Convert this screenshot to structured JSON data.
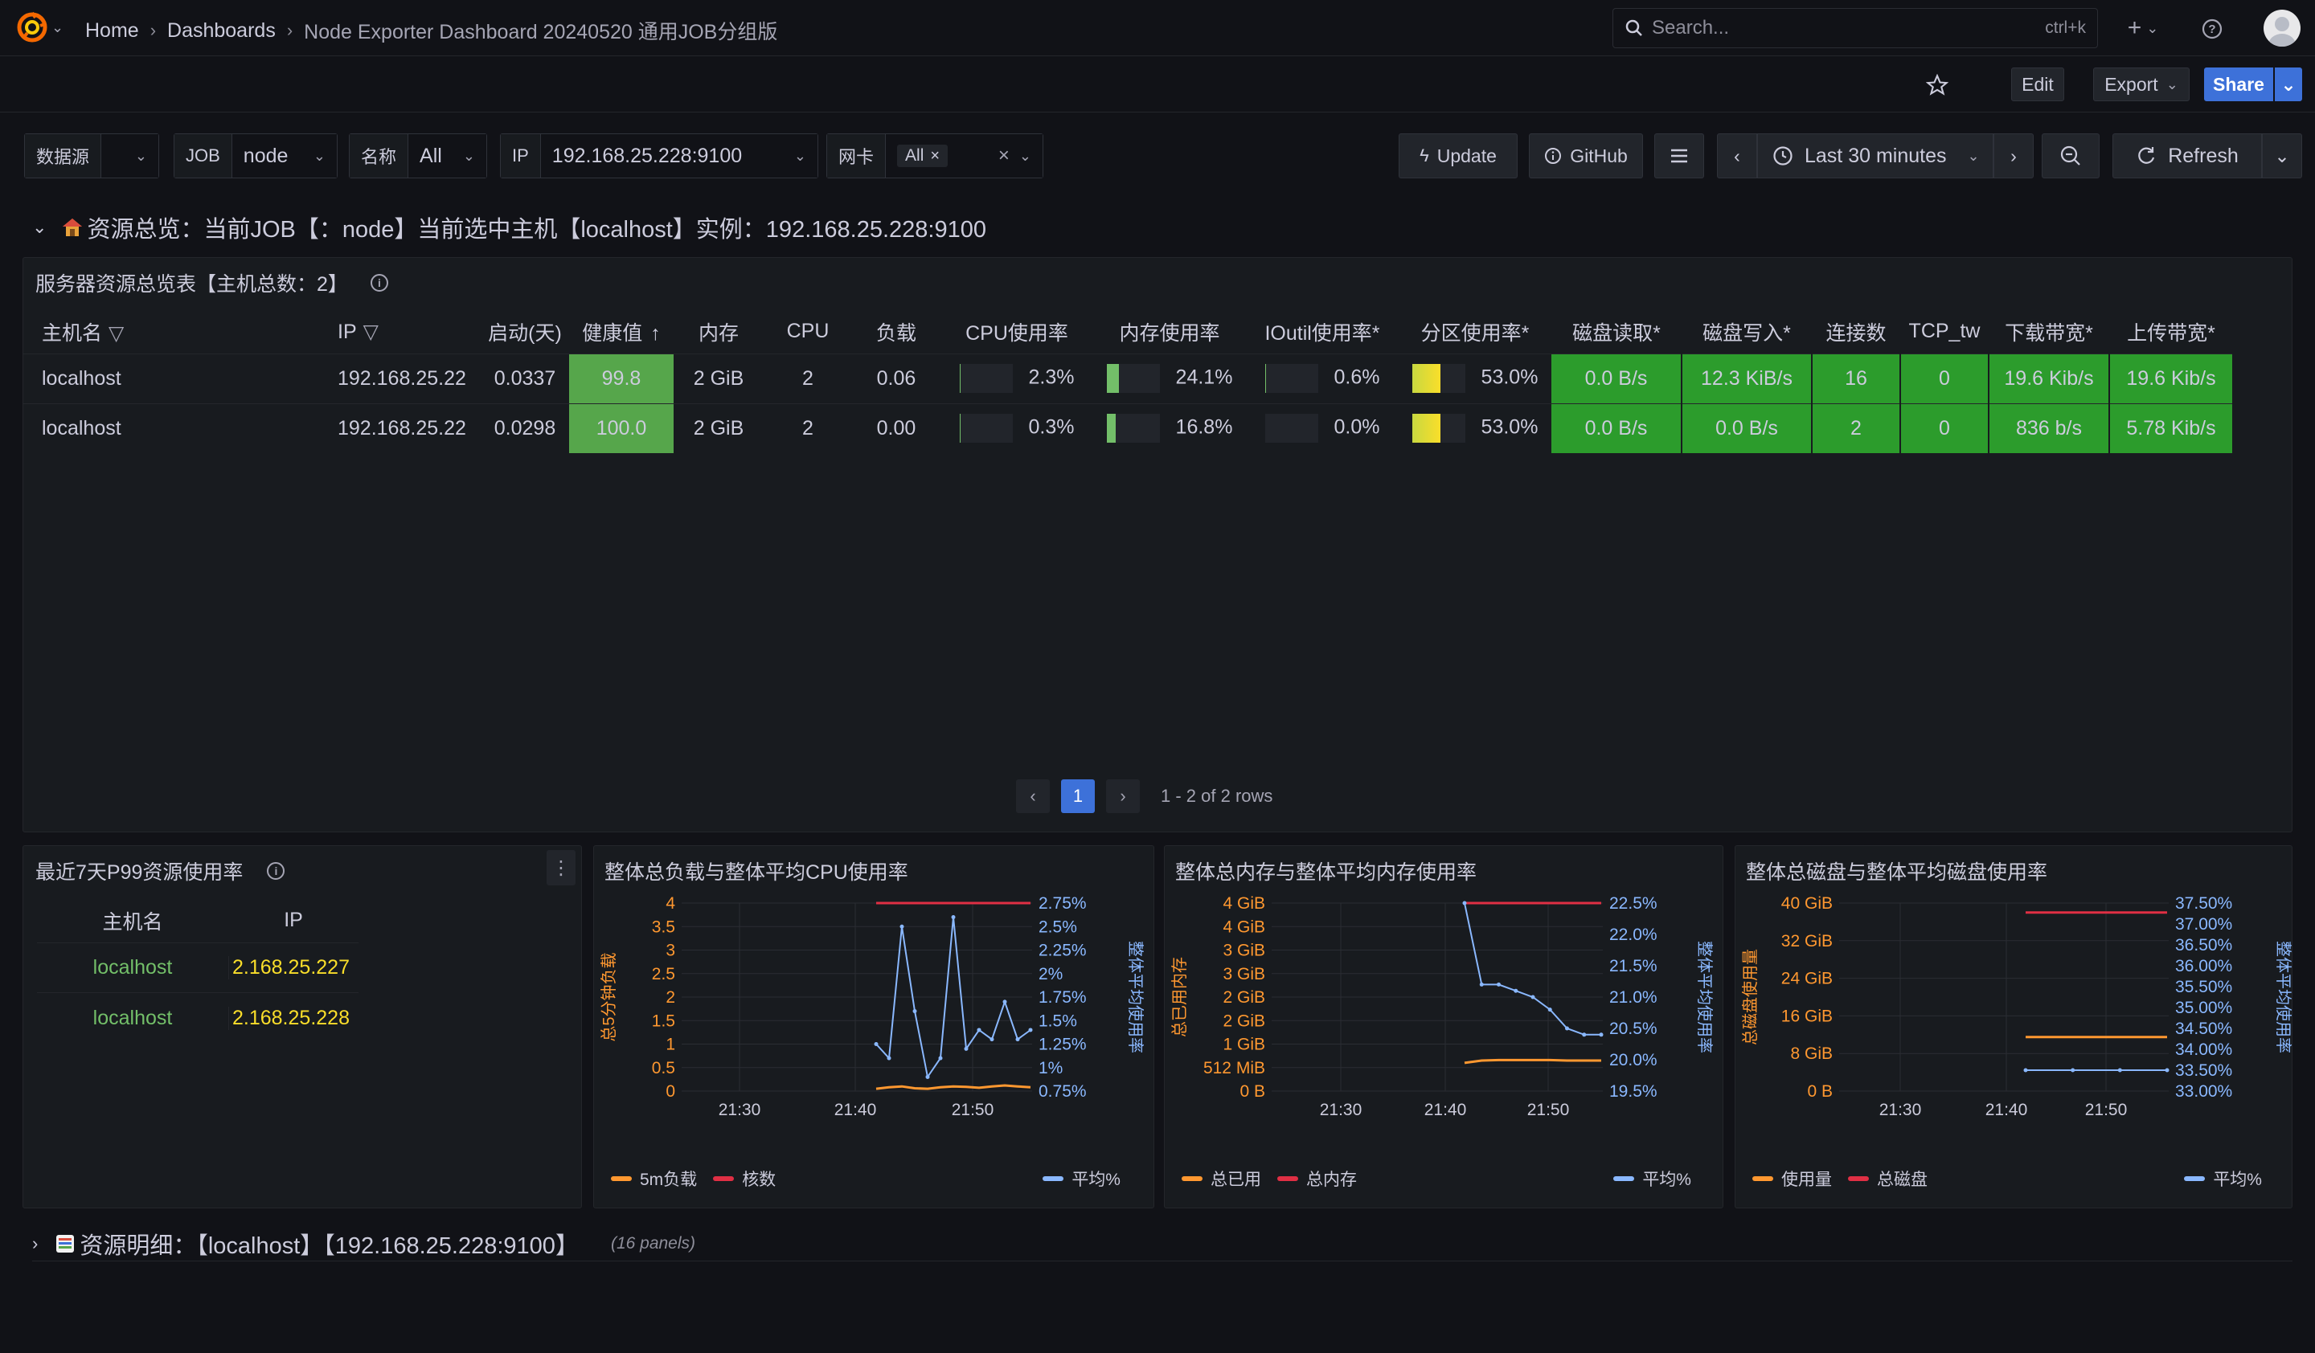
{
  "nav": {
    "breadcrumbs": [
      "Home",
      "Dashboards"
    ],
    "current": "Node Exporter Dashboard 20240520 通用JOB分组版",
    "search_placeholder": "Search...",
    "search_shortcut": "ctrl+k"
  },
  "actions": {
    "edit": "Edit",
    "export": "Export",
    "share": "Share"
  },
  "variables": {
    "datasource_label": "数据源",
    "job_label": "JOB",
    "job_value": "node",
    "name_label": "名称",
    "name_value": "All",
    "ip_label": "IP",
    "ip_value": "192.168.25.228:9100",
    "nic_label": "网卡",
    "nic_value": "All"
  },
  "toolbar": {
    "update": "Update",
    "github": "GitHub",
    "time_range": "Last 30 minutes",
    "refresh": "Refresh"
  },
  "row1": {
    "title": "资源总览：当前JOB【：node】当前选中主机【localhost】实例：192.168.25.228:9100"
  },
  "summary_panel": {
    "title": "服务器资源总览表【主机总数：2】",
    "columns": [
      "主机名",
      "IP",
      "启动(天)",
      "健康值",
      "内存",
      "CPU",
      "负载",
      "CPU使用率",
      "内存使用率",
      "IOutil使用率*",
      "分区使用率*",
      "磁盘读取*",
      "磁盘写入*",
      "连接数",
      "TCP_tw",
      "下载带宽*",
      "上传带宽*"
    ],
    "rows": [
      {
        "host": "localhost",
        "ip": "192.168.25.22",
        "uptime": "0.0337",
        "health": "99.8",
        "mem": "2 GiB",
        "cpu": "2",
        "load": "0.06",
        "cpu_pct": "2.3%",
        "cpu_frac": 0.023,
        "mem_pct": "24.1%",
        "mem_frac": 0.241,
        "io_pct": "0.6%",
        "io_frac": 0.006,
        "part_pct": "53.0%",
        "part_frac": 0.53,
        "disk_read": "0.0 B/s",
        "disk_write": "12.3 KiB/s",
        "conn": "16",
        "tcp_tw": "0",
        "down": "19.6 Kib/s",
        "up": "19.6 Kib/s"
      },
      {
        "host": "localhost",
        "ip": "192.168.25.22",
        "uptime": "0.0298",
        "health": "100.0",
        "mem": "2 GiB",
        "cpu": "2",
        "load": "0.00",
        "cpu_pct": "0.3%",
        "cpu_frac": 0.003,
        "mem_pct": "16.8%",
        "mem_frac": 0.168,
        "io_pct": "0.0%",
        "io_frac": 0.0,
        "part_pct": "53.0%",
        "part_frac": 0.53,
        "disk_read": "0.0 B/s",
        "disk_write": "0.0 B/s",
        "conn": "2",
        "tcp_tw": "0",
        "down": "836 b/s",
        "up": "5.78 Kib/s"
      }
    ],
    "pagination": {
      "page": "1",
      "summary": "1 - 2 of 2 rows"
    }
  },
  "p99_panel": {
    "title": "最近7天P99资源使用率",
    "columns": [
      "主机名",
      "IP"
    ],
    "rows": [
      {
        "host": "localhost",
        "ip": "2.168.25.227"
      },
      {
        "host": "localhost",
        "ip": "2.168.25.228"
      }
    ]
  },
  "chart_data": [
    {
      "type": "line",
      "title": "整体总负载与整体平均CPU使用率",
      "ylabel": "总5分钟负载",
      "ylabel_right": "整体平均使用率",
      "x_ticks": [
        "21:30",
        "21:40",
        "21:50"
      ],
      "y_ticks": [
        "0",
        "0.5",
        "1",
        "1.5",
        "2",
        "2.5",
        "3",
        "3.5",
        "4"
      ],
      "y_right_ticks": [
        "0.75%",
        "1%",
        "1.25%",
        "1.5%",
        "1.75%",
        "2%",
        "2.25%",
        "2.5%",
        "2.75%"
      ],
      "series": [
        {
          "name": "5m负载",
          "color": "#ff9830",
          "values": [
            0.05,
            0.08,
            0.1,
            0.06,
            0.05,
            0.08,
            0.1,
            0.09,
            0.07,
            0.1,
            0.12,
            0.1,
            0.08
          ]
        },
        {
          "name": "核数",
          "color": "#e02f44",
          "values": [
            4,
            4,
            4,
            4,
            4,
            4,
            4,
            4,
            4,
            4,
            4,
            4,
            4
          ]
        },
        {
          "name": "平均%",
          "color": "#8ab8ff",
          "values": [
            1.25,
            1.1,
            2.5,
            1.6,
            0.9,
            1.1,
            2.6,
            1.2,
            1.4,
            1.3,
            1.7,
            1.3,
            1.4
          ]
        }
      ],
      "legend": [
        "5m负载",
        "核数",
        "平均%"
      ]
    },
    {
      "type": "line",
      "title": "整体总内存与整体平均内存使用率",
      "ylabel": "总已用内存",
      "ylabel_right": "整体平均使用率",
      "x_ticks": [
        "21:30",
        "21:40",
        "21:50"
      ],
      "y_ticks": [
        "0 B",
        "512 MiB",
        "1 GiB",
        "2 GiB",
        "2 GiB",
        "3 GiB",
        "3 GiB",
        "4 GiB",
        "4 GiB"
      ],
      "y_right_ticks": [
        "19.5%",
        "20.0%",
        "20.5%",
        "21.0%",
        "21.5%",
        "22.0%",
        "22.5%"
      ],
      "series": [
        {
          "name": "总已用",
          "color": "#ff9830",
          "values": [
            0.6,
            0.65,
            0.66,
            0.66,
            0.66,
            0.66,
            0.65,
            0.65,
            0.65
          ]
        },
        {
          "name": "总内存",
          "color": "#e02f44",
          "values": [
            4,
            4,
            4,
            4,
            4,
            4,
            4,
            4,
            4
          ]
        },
        {
          "name": "平均%",
          "color": "#8ab8ff",
          "values": [
            22.5,
            21.2,
            21.2,
            21.1,
            21.0,
            20.8,
            20.5,
            20.4,
            20.4
          ]
        }
      ],
      "legend": [
        "总已用",
        "总内存",
        "平均%"
      ]
    },
    {
      "type": "line",
      "title": "整体总磁盘与整体平均磁盘使用率",
      "ylabel": "总磁盘使用量",
      "ylabel_right": "整体平均使用率",
      "x_ticks": [
        "21:30",
        "21:40",
        "21:50"
      ],
      "y_ticks": [
        "0 B",
        "8 GiB",
        "16 GiB",
        "24 GiB",
        "32 GiB",
        "40 GiB"
      ],
      "y_right_ticks": [
        "33.00%",
        "33.50%",
        "34.00%",
        "34.50%",
        "35.00%",
        "35.50%",
        "36.00%",
        "36.50%",
        "37.00%",
        "37.50%"
      ],
      "series": [
        {
          "name": "使用量",
          "color": "#ff9830",
          "values": [
            11.5,
            11.5,
            11.5,
            11.5
          ]
        },
        {
          "name": "总磁盘",
          "color": "#e02f44",
          "values": [
            38,
            38,
            38,
            38
          ]
        },
        {
          "name": "平均%",
          "color": "#8ab8ff",
          "values": [
            33.5,
            33.5,
            33.5,
            33.5
          ]
        }
      ],
      "legend": [
        "使用量",
        "总磁盘",
        "平均%"
      ]
    }
  ],
  "row2": {
    "title": "资源明细：【localhost】【192.168.25.228:9100】",
    "panels_count": "(16 panels)"
  }
}
